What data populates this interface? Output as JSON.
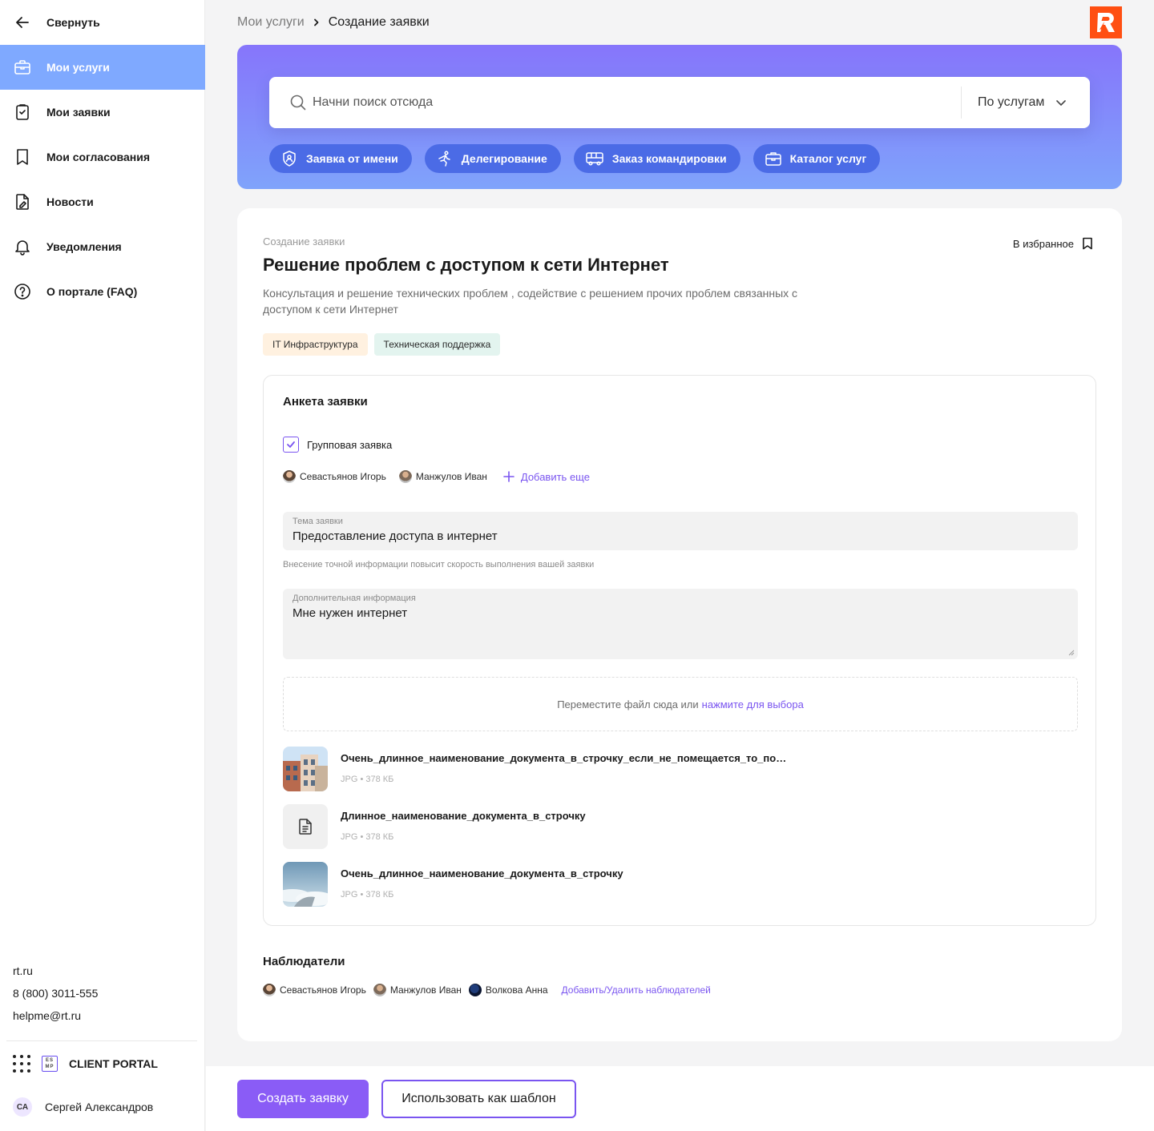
{
  "sidebar": {
    "collapse_label": "Свернуть",
    "items": [
      {
        "label": "Мои услуги",
        "icon": "briefcase-icon",
        "active": true
      },
      {
        "label": "Мои заявки",
        "icon": "clipboard-check-icon",
        "active": false
      },
      {
        "label": "Мои согласования",
        "icon": "bookmark-icon",
        "active": false
      },
      {
        "label": "Новости",
        "icon": "document-pen-icon",
        "active": false
      },
      {
        "label": "Уведомления",
        "icon": "bell-icon",
        "active": false
      },
      {
        "label": "О портале (FAQ)",
        "icon": "question-icon",
        "active": false
      }
    ],
    "contacts": {
      "site": "rt.ru",
      "phone": "8 (800) 3011-555",
      "email": "helpme@rt.ru"
    },
    "portal": {
      "badge": "ES MP",
      "label": "CLIENT PORTAL"
    },
    "user": {
      "initials": "СА",
      "name": "Сергей Александров"
    }
  },
  "breadcrumb": {
    "parent": "Мои услуги",
    "current": "Создание заявки"
  },
  "search": {
    "placeholder": "Начни поиск отсюда",
    "filter_label": "По услугам",
    "chips": [
      {
        "label": "Заявка от имени",
        "icon": "shield-person-icon"
      },
      {
        "label": "Делегирование",
        "icon": "running-person-icon"
      },
      {
        "label": "Заказ командировки",
        "icon": "bus-icon"
      },
      {
        "label": "Каталог услуг",
        "icon": "briefcase-icon"
      }
    ]
  },
  "request": {
    "overline": "Создание заявки",
    "title": "Решение проблем с доступом к сети Интернет",
    "favorite_label": "В избранное",
    "description": "Консультация и решение технических проблем , содействие с решением прочих проблем связанных с доступом к сети Интернет",
    "tags": [
      {
        "label": "IT Инфраструктура",
        "color": "#fff1e0"
      },
      {
        "label": "Техническая поддержка",
        "color": "#e3f4ef"
      }
    ]
  },
  "form": {
    "title": "Анкета заявки",
    "group_label": "Групповая заявка",
    "group_checked": true,
    "members": [
      "Севастьянов Игорь",
      "Манжулов Иван"
    ],
    "add_more_label": "Добавить еще",
    "subject": {
      "label": "Тема заявки",
      "value": "Предоставление доступа в интернет",
      "hint": "Внесение точной информации повысит скорость выполнения вашей заявки"
    },
    "extra": {
      "label": "Дополнительная информация",
      "value": "Мне нужен интернет"
    },
    "dropzone": {
      "text": "Переместите файл сюда или",
      "link": "нажмите для выбора"
    },
    "files": [
      {
        "name": "Очень_длинное_наименование_документа_в_строчку_если_не_помещается_то_показываем_многоточие",
        "meta": "JPG • 378 КБ",
        "thumb": "building-photo"
      },
      {
        "name": "Длинное_наименование_документа_в_строчку",
        "meta": "JPG • 378 КБ",
        "thumb": "document-icon"
      },
      {
        "name": "Очень_длинное_наименование_документа_в_строчку",
        "meta": "JPG • 378 КБ",
        "thumb": "sky-photo"
      }
    ]
  },
  "watchers": {
    "title": "Наблюдатели",
    "people": [
      "Севастьянов Игорь",
      "Манжулов Иван",
      "Волкова Анна"
    ],
    "manage_label": "Добавить/Удалить наблюдателей"
  },
  "footer": {
    "primary_label": "Создать заявку",
    "secondary_label": "Использовать как шаблон"
  },
  "colors": {
    "accent": "#7a55f0",
    "sidebar_active": "#7fa9ff",
    "chip": "#4b6be6",
    "logo": "#ff4f12"
  }
}
